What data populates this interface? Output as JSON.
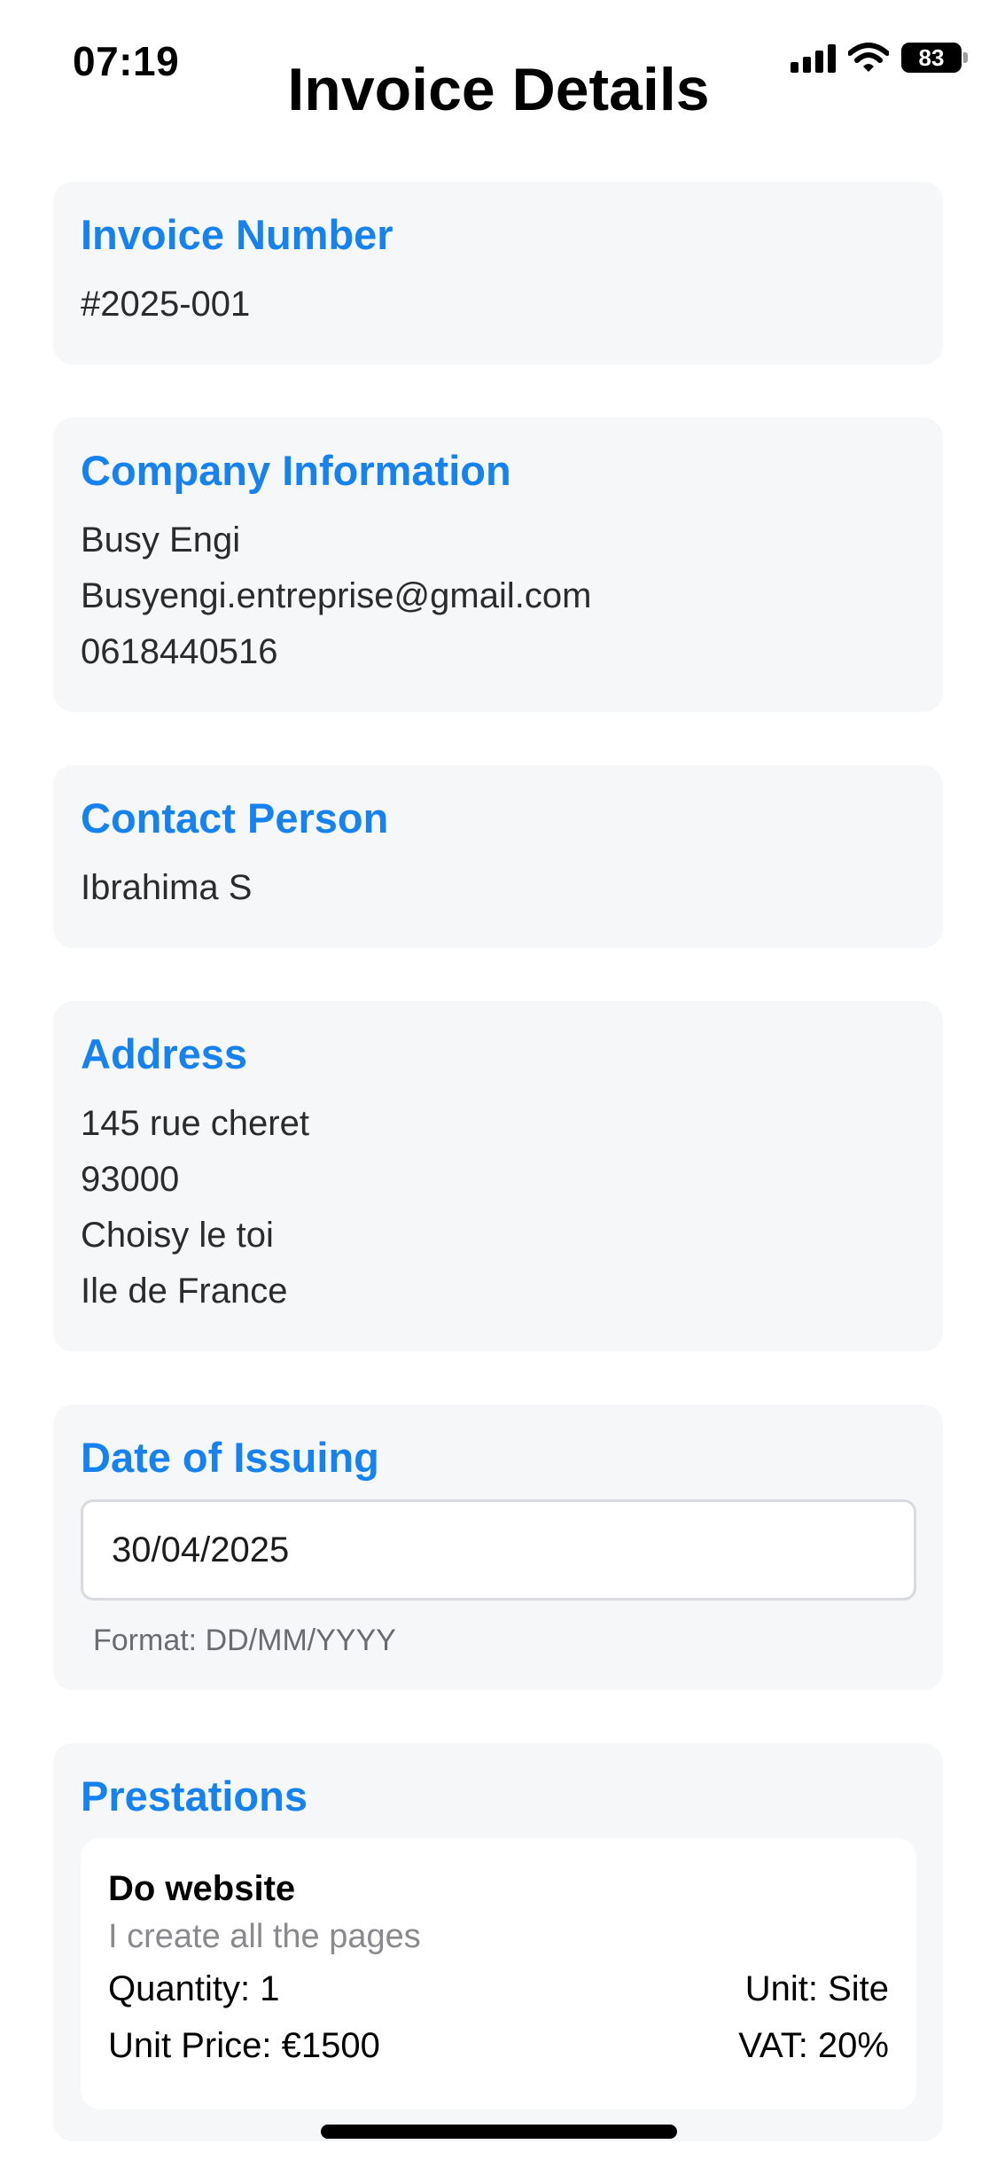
{
  "status_bar": {
    "time": "07:19",
    "battery": "83"
  },
  "header": {
    "title": "Invoice Details"
  },
  "invoice_number": {
    "title": "Invoice Number",
    "value": "#2025-001"
  },
  "company": {
    "title": "Company Information",
    "name": "Busy Engi",
    "email": "Busyengi.entreprise@gmail.com",
    "phone": "0618440516"
  },
  "contact": {
    "title": "Contact Person",
    "name": "Ibrahima S"
  },
  "address": {
    "title": "Address",
    "street": "145 rue cheret",
    "postal_code": "93000",
    "city": "Choisy le toi",
    "region": "Ile de France"
  },
  "date_of_issuing": {
    "title": "Date of Issuing",
    "value": "30/04/2025",
    "hint": "Format: DD/MM/YYYY"
  },
  "prestations": {
    "title": "Prestations",
    "items": [
      {
        "name": "Do website",
        "description": "I create all the pages",
        "quantity": "Quantity: 1",
        "unit": "Unit: Site",
        "unit_price": "Unit Price: €1500",
        "vat": "VAT: 20%"
      }
    ]
  },
  "colors": {
    "accent": "#1682f0",
    "card_background": "#f6f7f9"
  }
}
